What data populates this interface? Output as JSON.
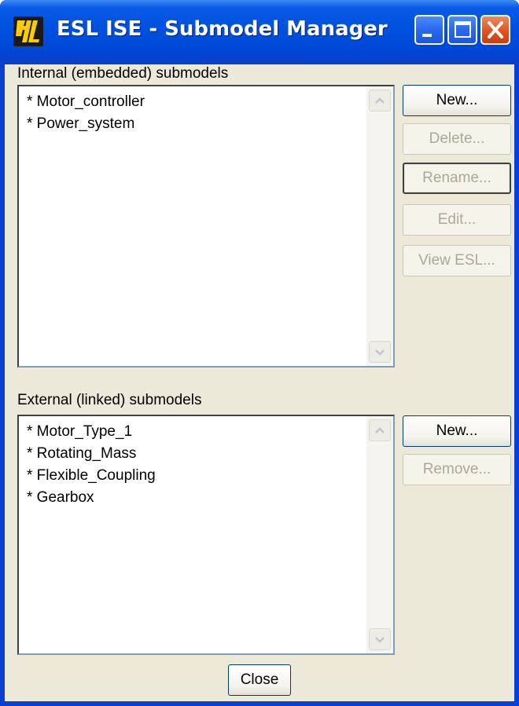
{
  "window": {
    "title": "ESL ISE - Submodel Manager",
    "icon": "esl-app-icon",
    "controls": [
      "minimize-icon",
      "maximize-icon",
      "close-icon"
    ]
  },
  "internal": {
    "label": "Internal (embedded) submodels",
    "items": [
      "* Motor_controller",
      "* Power_system"
    ],
    "buttons": [
      {
        "label": "New...",
        "enabled": true
      },
      {
        "label": "Delete...",
        "enabled": false
      },
      {
        "label": "Rename...",
        "enabled": false
      },
      {
        "label": "Edit...",
        "enabled": false
      },
      {
        "label": "View ESL...",
        "enabled": false
      }
    ]
  },
  "external": {
    "label": "External (linked) submodels",
    "items": [
      "* Motor_Type_1",
      "* Rotating_Mass",
      "* Flexible_Coupling",
      "* Gearbox"
    ],
    "buttons": [
      {
        "label": "New...",
        "enabled": true
      },
      {
        "label": "Remove...",
        "enabled": false
      }
    ]
  },
  "footer": {
    "close_label": "Close"
  },
  "colors": {
    "titlebar": "#0050e0",
    "client": "#ece9d8",
    "close_button": "#e0521e",
    "disabled_text": "#aca899"
  }
}
